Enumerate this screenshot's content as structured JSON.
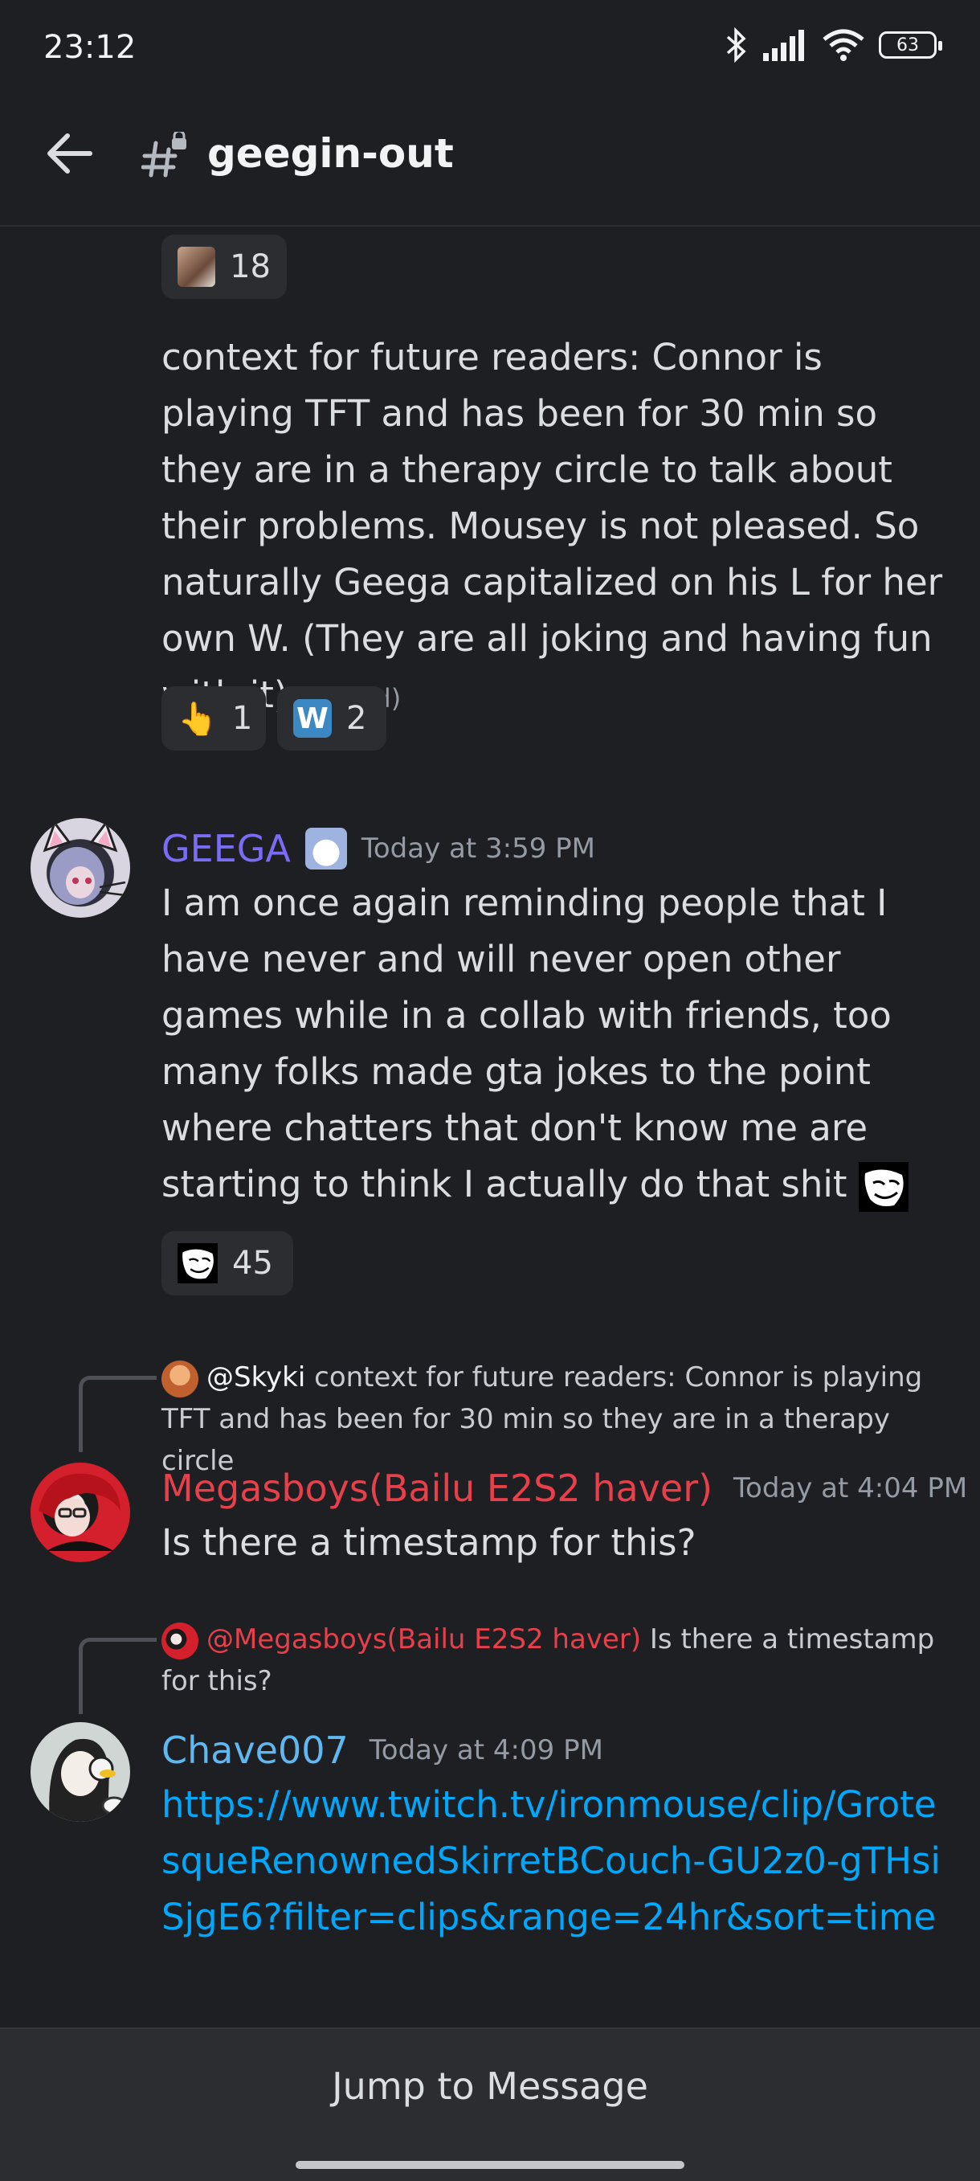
{
  "status": {
    "time": "23:12",
    "battery": "63"
  },
  "header": {
    "channel": "geegin-out"
  },
  "top_reaction": {
    "count": "18"
  },
  "context_message": {
    "text": "context for future readers: Connor is playing TFT and has been for 30 min so they are in a therapy circle to talk about their problems. Mousey is not pleased. So naturally Geega capitalized on his L for her own W. (They are all joking and having fun with it)",
    "edited": "(edited)",
    "reactions": [
      {
        "emoji": "👆",
        "count": "1"
      },
      {
        "emoji": "W",
        "count": "2"
      }
    ]
  },
  "geega_message": {
    "username": "GEEGA",
    "timestamp": "Today at 3:59 PM",
    "text": "I am once again reminding people that I have never and will never open other games while in a collab with friends, too many folks made gta jokes to the point where chatters that don't know me are starting to think I actually do that shit",
    "reaction_count": "45",
    "name_color": "#7b6cf6"
  },
  "mega_message": {
    "reply_mention": "@Skyki",
    "reply_text": "context for future readers: Connor is playing TFT and has been for 30 min so they are in a therapy circle",
    "username": "Megasboys(Bailu E2S2 haver)",
    "timestamp": "Today at 4:04 PM",
    "text": "Is there a timestamp for this?",
    "name_color": "#e8404a"
  },
  "chave_message": {
    "reply_mention": "@Megasboys(Bailu E2S2 haver)",
    "reply_text": "Is there a timestamp for this?",
    "username": "Chave007",
    "timestamp": "Today at 4:09 PM",
    "link": "https://www.twitch.tv/ironmouse/clip/GrotesqueRenownedSkirretBCouch-GU2z0-gTHsiSjgE6?filter=clips&range=24hr&sort=time",
    "name_color": "#60b8f0"
  },
  "footer": {
    "jump_label": "Jump to Message"
  }
}
